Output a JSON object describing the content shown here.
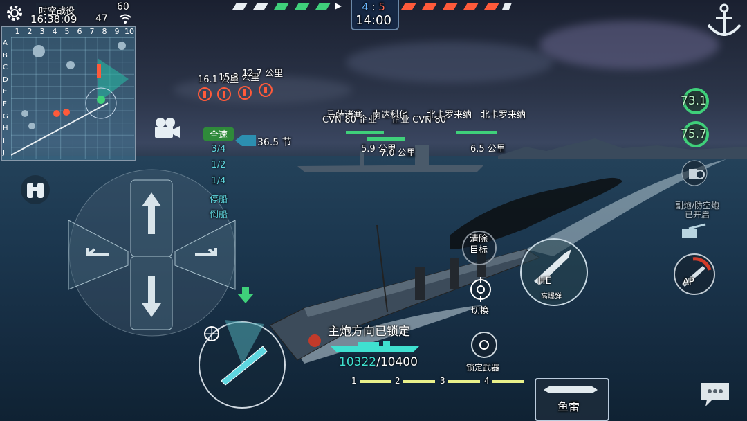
{
  "topleft": {
    "mode": "时空战役",
    "time": "16:38:09",
    "fps": "60",
    "ping": "47"
  },
  "minimap": {
    "cols": [
      "1",
      "2",
      "3",
      "4",
      "5",
      "6",
      "7",
      "8",
      "9",
      "10"
    ],
    "rows": [
      "A",
      "B",
      "C",
      "D",
      "E",
      "F",
      "G",
      "H",
      "I",
      "J"
    ]
  },
  "score": {
    "blue": "4",
    "sep": ":",
    "red": "5",
    "timer": "14:00"
  },
  "enemies": {
    "labels": [
      "16.1 公里",
      "15.3 公里",
      "12.7 公里"
    ]
  },
  "allies": [
    {
      "name": "马萨诸塞",
      "dist": "5.9 公里"
    },
    {
      "name": "CVN-80 企业",
      "dist": "7.0 公里"
    },
    {
      "name": "南达科他",
      "dist": ""
    },
    {
      "name": "企业 CVN-80",
      "dist": ""
    },
    {
      "name": "北卡罗来纳",
      "dist": "6.5 公里"
    },
    {
      "name": "北卡罗来纳",
      "dist": ""
    }
  ],
  "speed": {
    "levels": [
      "全速",
      "3/4",
      "1/2",
      "1/4",
      "停船",
      "倒船"
    ],
    "value": "36.5 节"
  },
  "right": {
    "hp1": "73.1",
    "hp2": "75.7",
    "secondary_label": "副炮/防空炮",
    "secondary_status": "已开启",
    "ap_label": "AP"
  },
  "center": {
    "clear_target": "清除\n目标",
    "he_label": "HE",
    "he_sub": "高爆弹",
    "switch_label": "切换",
    "lock_weapon": "锁定武器",
    "turret_status": "主炮方向已锁定",
    "hp_current": "10322",
    "hp_max": "/10400",
    "weapon_slots": [
      "1",
      "2",
      "3",
      "4"
    ],
    "torpedo": "鱼雷"
  },
  "colors": {
    "blue_team": "#6ab7ff",
    "red_team": "#ff6a55",
    "ally_green": "#3fd07a",
    "hp_cyan": "#3fe0d0"
  }
}
